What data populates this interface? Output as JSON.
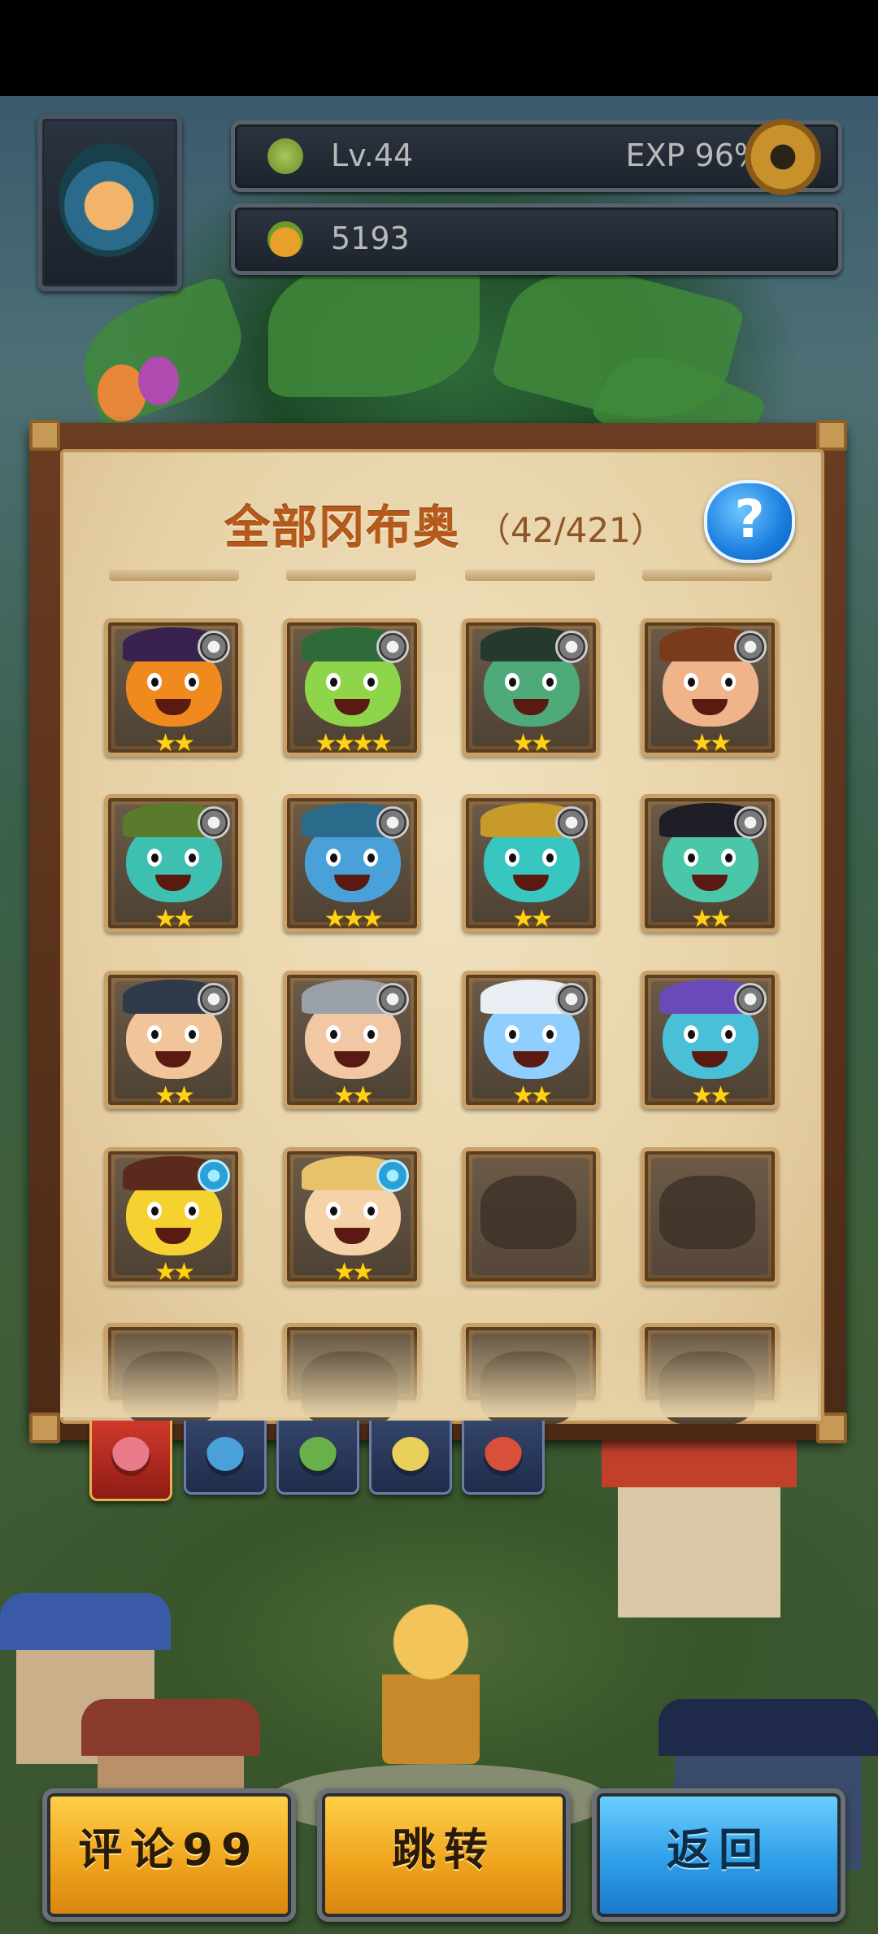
{
  "hud": {
    "level_text": "Lv.44",
    "exp_text": "EXP 96%",
    "coins_text": "5193",
    "icons": [
      "avatar-portrait",
      "level-sprout-icon",
      "acorn-coin-icon",
      "settings-gear-icon"
    ]
  },
  "panel": {
    "title": "全部冈布奥",
    "count": "（42/421）",
    "help_label": "?"
  },
  "grid": [
    {
      "name": "pumpkin-wizard",
      "stars": "★★",
      "badge": "arrow",
      "color": "#f08a1e",
      "hat": "#3a2250"
    },
    {
      "name": "green-general",
      "stars": "★★★★",
      "badge": "arrow",
      "color": "#8fd54a",
      "hat": "#2f6a3a"
    },
    {
      "name": "frankenstein",
      "stars": "★★",
      "badge": "arrow",
      "color": "#4faa7a",
      "hat": "#253a2c"
    },
    {
      "name": "soccer-player",
      "stars": "★★",
      "badge": "arrow",
      "color": "#f1b38a",
      "hat": "#7a3a1c"
    },
    {
      "name": "farmer-slime",
      "stars": "★★",
      "badge": "arrow",
      "color": "#3ec0b0",
      "hat": "#5a7a2c"
    },
    {
      "name": "dark-sea-king",
      "stars": "★★★",
      "badge": "arrow",
      "color": "#4aa0d8",
      "hat": "#2a6a8a"
    },
    {
      "name": "golden-knight",
      "stars": "★★",
      "badge": "arrow",
      "color": "#38c6c0",
      "hat": "#c89a2a"
    },
    {
      "name": "ninja-gold",
      "stars": "★★",
      "badge": "arrow",
      "color": "#4ac6a8",
      "hat": "#1e1e26"
    },
    {
      "name": "warrior-face",
      "stars": "★★",
      "badge": "arrow",
      "color": "#f2c49a",
      "hat": "#2f3a4a"
    },
    {
      "name": "armored-knight",
      "stars": "★★",
      "badge": "arrow",
      "color": "#f2c7a4",
      "hat": "#9aa0a8"
    },
    {
      "name": "white-tiger",
      "stars": "★★",
      "badge": "arrow",
      "color": "#8fcfff",
      "hat": "#e9eef4"
    },
    {
      "name": "winged-warlord",
      "stars": "★★",
      "badge": "arrow",
      "color": "#4ac0d8",
      "hat": "#6a4ab8"
    },
    {
      "name": "rocker-bird",
      "stars": "★★",
      "badge": "swirl",
      "color": "#f6d230",
      "hat": "#5a2a1c"
    },
    {
      "name": "straw-hat-kid",
      "stars": "★★",
      "badge": "swirl",
      "color": "#f6d2a8",
      "hat": "#e8c26a"
    },
    {
      "name": "locked-1",
      "stars": "",
      "badge": "",
      "color": "",
      "hat": ""
    },
    {
      "name": "locked-2",
      "stars": "",
      "badge": "",
      "color": "",
      "hat": ""
    },
    {
      "name": "locked-3",
      "stars": "",
      "badge": "",
      "color": "",
      "hat": ""
    },
    {
      "name": "locked-4",
      "stars": "",
      "badge": "",
      "color": "",
      "hat": ""
    },
    {
      "name": "locked-5",
      "stars": "",
      "badge": "",
      "color": "",
      "hat": ""
    },
    {
      "name": "locked-6",
      "stars": "",
      "badge": "",
      "color": "",
      "hat": ""
    }
  ],
  "tabs": [
    {
      "name": "all-factions",
      "active": true,
      "color": "#e87a8a"
    },
    {
      "name": "faction-blue",
      "active": false,
      "color": "#4aa0d8"
    },
    {
      "name": "faction-green",
      "active": false,
      "color": "#6ab04a"
    },
    {
      "name": "faction-yellow",
      "active": false,
      "color": "#e8d05a"
    },
    {
      "name": "faction-red",
      "active": false,
      "color": "#d8503a"
    }
  ],
  "buttons": {
    "comment": "评论99",
    "jump": "跳转",
    "back": "返回"
  }
}
